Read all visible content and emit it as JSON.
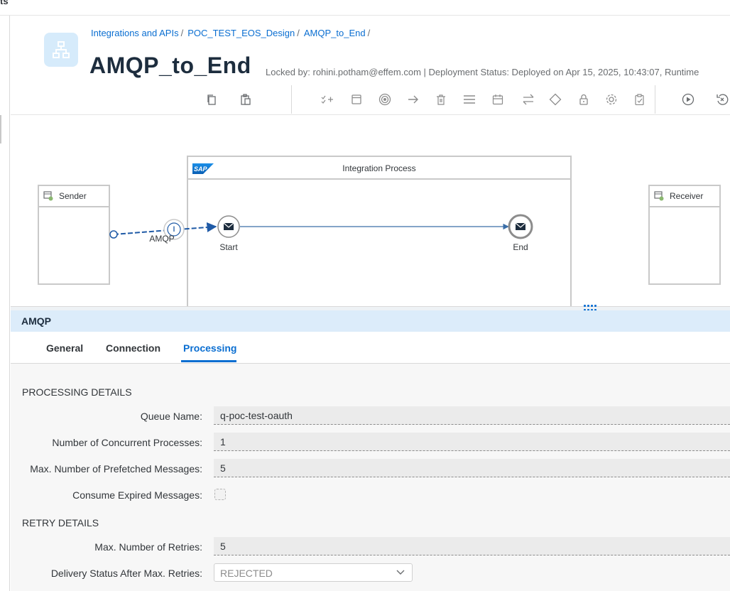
{
  "top_strip": {
    "text": "ts"
  },
  "header": {
    "breadcrumb": [
      "Integrations and APIs",
      "POC_TEST_EOS_Design",
      "AMQP_to_End"
    ],
    "breadcrumb_sep": "/",
    "title": "AMQP_to_End",
    "meta": "Locked by: rohini.potham@effem.com | Deployment Status: Deployed on Apr 15, 2025, 10:43:07, Runtime"
  },
  "toolbar": {
    "icons": [
      "copy-icon",
      "paste-icon",
      "add-validation-icon",
      "frame-icon",
      "target-icon",
      "arrow-right-icon",
      "delete-icon",
      "menu-icon",
      "calendar-icon",
      "swap-icon",
      "gateway-icon",
      "lock-icon",
      "settings-icon",
      "clipboard-check-icon",
      "play-icon",
      "undo-icon"
    ]
  },
  "canvas": {
    "sender_label": "Sender",
    "receiver_label": "Receiver",
    "pool_title": "Integration Process",
    "sap_logo_text": "SAP",
    "channel_label": "AMQP",
    "start_label": "Start",
    "end_label": "End"
  },
  "props": {
    "title": "AMQP",
    "tabs": [
      "General",
      "Connection",
      "Processing"
    ],
    "active_tab": "Processing",
    "processing_section": "PROCESSING DETAILS",
    "fields": [
      {
        "label": "Queue Name:",
        "value": "q-poc-test-oauth"
      },
      {
        "label": "Number of Concurrent Processes:",
        "value": "1"
      },
      {
        "label": "Max. Number of Prefetched Messages:",
        "value": "5"
      }
    ],
    "consume_expired_label": "Consume Expired Messages:",
    "retry_section": "RETRY DETAILS",
    "retries_label": "Max. Number of Retries:",
    "retries_value": "5",
    "delivery_label": "Delivery Status After Max. Retries:",
    "delivery_value": "REJECTED"
  },
  "colors": {
    "accent": "#0a6ed1",
    "panel_header": "#dcecfa",
    "border": "#c9c9c9"
  }
}
